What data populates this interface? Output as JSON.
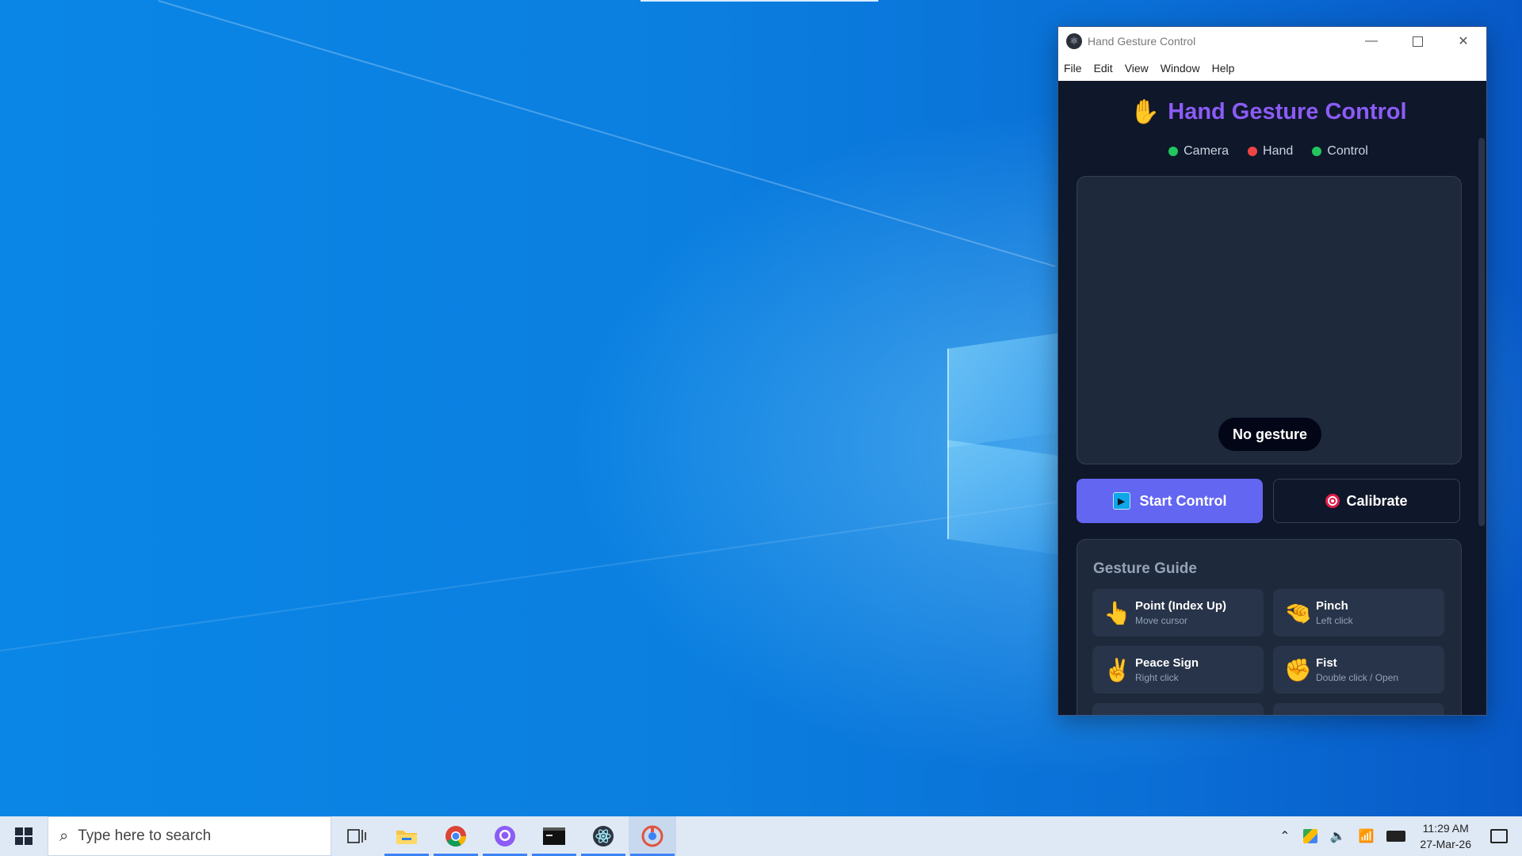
{
  "window": {
    "title": "Hand Gesture Control",
    "menu": [
      "File",
      "Edit",
      "View",
      "Window",
      "Help"
    ]
  },
  "app": {
    "heading": "Hand Gesture Control",
    "status": [
      {
        "label": "Camera",
        "color": "#22c55e"
      },
      {
        "label": "Hand",
        "color": "#ef4444"
      },
      {
        "label": "Control",
        "color": "#22c55e"
      }
    ],
    "gesture_status": "No gesture",
    "start_label": "Start Control",
    "calibrate_label": "Calibrate",
    "guide_title": "Gesture Guide",
    "gestures": [
      {
        "emoji": "👆",
        "name": "Point (Index Up)",
        "desc": "Move cursor"
      },
      {
        "emoji": "🤏",
        "name": "Pinch",
        "desc": "Left click"
      },
      {
        "emoji": "✌️",
        "name": "Peace Sign",
        "desc": "Right click"
      },
      {
        "emoji": "✊",
        "name": "Fist",
        "desc": "Double click / Open"
      }
    ]
  },
  "taskbar": {
    "search_placeholder": "Type here to search",
    "time": "11:29 AM",
    "date": "27-Mar-26"
  },
  "colors": {
    "accent": "#8b5cf6",
    "button": "#6366f1",
    "app_bg": "#0f172a",
    "panel_bg": "#1e293b"
  }
}
